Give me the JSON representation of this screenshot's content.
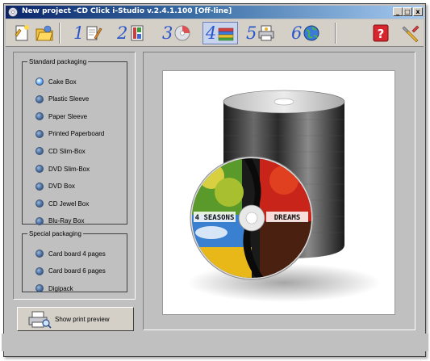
{
  "window": {
    "title": "New project -CD Click i-Studio v.2.4.1.100 [Off-line]",
    "controls": {
      "minimize": "_",
      "maximize": "□",
      "close": "x"
    }
  },
  "toolbar": {
    "icons": [
      "new-project-icon",
      "open-project-icon"
    ],
    "steps": [
      {
        "number": "1",
        "icon": "edit-text-icon"
      },
      {
        "number": "2",
        "icon": "layout-icon"
      },
      {
        "number": "3",
        "icon": "cd-paint-icon"
      },
      {
        "number": "4",
        "icon": "packaging-icon",
        "active": true
      },
      {
        "number": "5",
        "icon": "print-icon"
      },
      {
        "number": "6",
        "icon": "web-globe-icon"
      }
    ],
    "right_icons": [
      "help-icon",
      "settings-tools-icon"
    ]
  },
  "standard_packaging": {
    "legend": "Standard packaging",
    "options": [
      "Cake Box",
      "Plastic Sleeve",
      "Paper Sleeve",
      "Printed Paperboard",
      "CD Slim-Box",
      "DVD Slim-Box",
      "DVD Box",
      "CD Jewel Box",
      "Blu-Ray Box"
    ],
    "selected": "Cake Box"
  },
  "special_packaging": {
    "legend": "Special packaging",
    "options": [
      "Card board 4 pages",
      "Card board 6 pages",
      "Digipack"
    ]
  },
  "preview_button": {
    "label": "Show print preview"
  },
  "disc_art": {
    "text_left": "4 SEASONS",
    "text_right": "DREAMS"
  },
  "colors": {
    "title_start": "#0a246a",
    "title_end": "#a6caf0",
    "step_number": "#2a55c8",
    "panel": "#c0c0c0"
  }
}
